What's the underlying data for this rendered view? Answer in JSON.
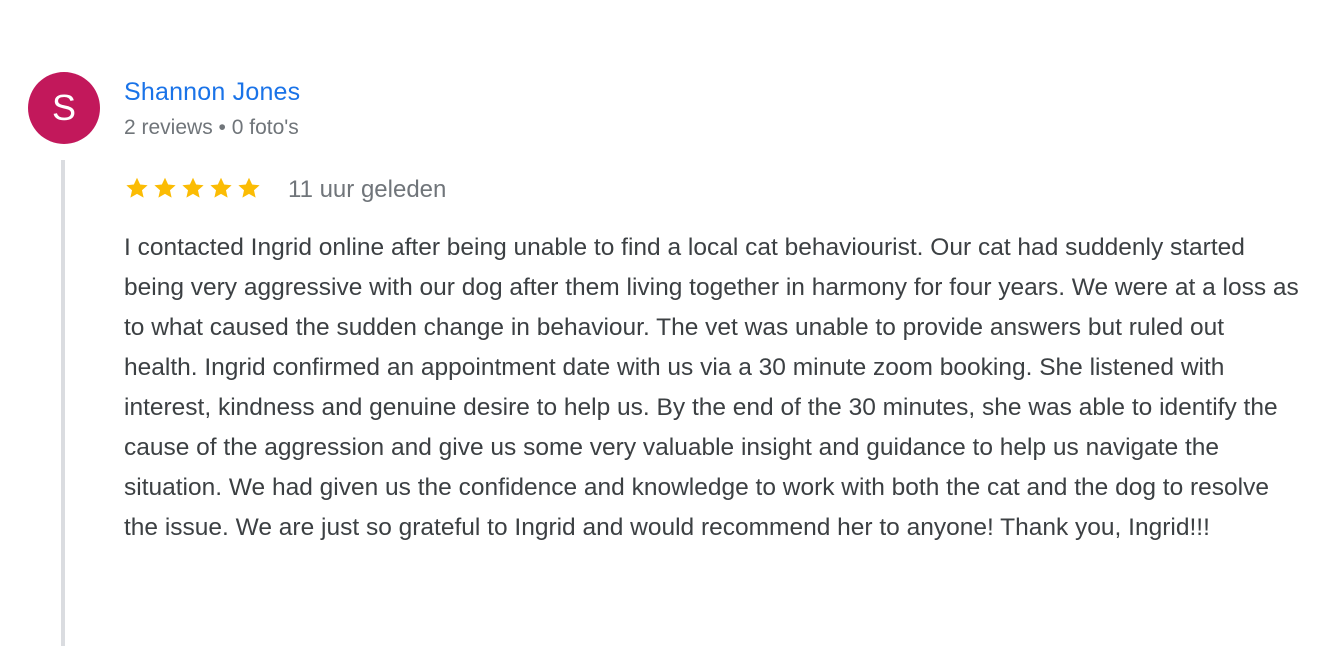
{
  "reviewer": {
    "avatar_letter": "S",
    "avatar_color": "#c2185b",
    "name": "Shannon Jones",
    "meta": "2 reviews • 0 foto's",
    "name_color": "#1a73e8"
  },
  "review": {
    "rating": 5,
    "rating_max": 5,
    "star_icon": "star-icon",
    "star_color": "#fbbc04",
    "time": "11 uur geleden",
    "text": "I contacted Ingrid online after being unable to find a local cat behaviourist. Our cat had suddenly started being very aggressive with our dog after them living together in harmony for four years. We were at a loss as to what caused the sudden change in behaviour. The vet was unable to provide answers but ruled out health. Ingrid confirmed an appointment date with us via a 30 minute zoom booking. She listened with interest, kindness and genuine desire to help us. By the end of the 30 minutes, she was able to identify the cause of the aggression and give us some very valuable insight and guidance to help us navigate the situation. We had given us the confidence and knowledge to work with both the cat and the dog to resolve the issue. We are just so grateful to Ingrid and would recommend her to anyone! Thank you, Ingrid!!!"
  }
}
